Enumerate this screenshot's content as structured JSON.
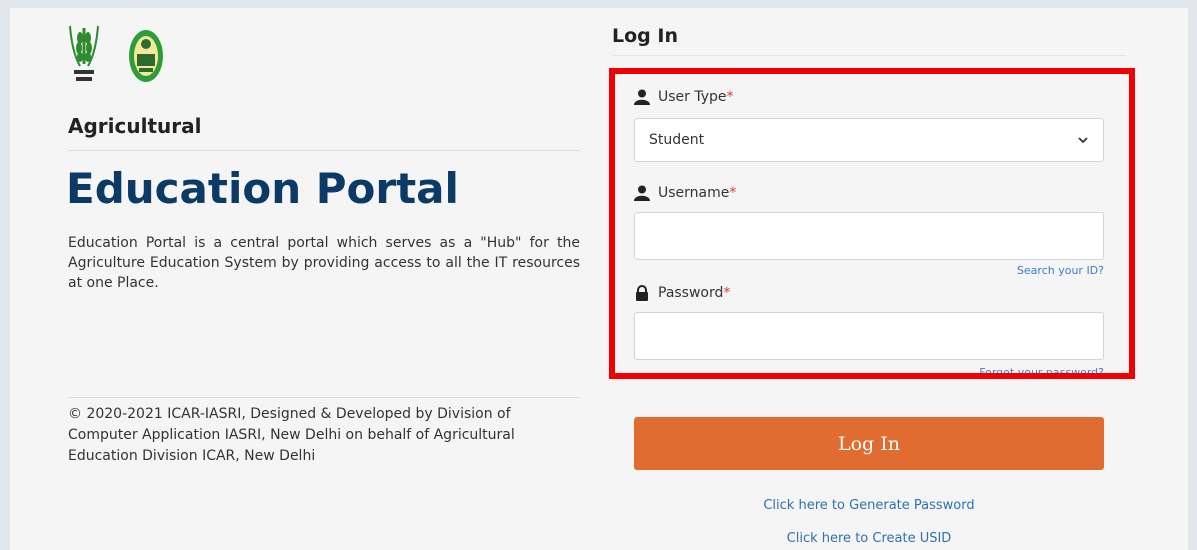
{
  "left": {
    "subtitle": "Agricultural",
    "title": "Education Portal",
    "description": "Education Portal is a central portal which serves as a \"Hub\" for the Agriculture Education System by providing access to all the IT resources at one Place.",
    "footer": "© 2020-2021 ICAR-IASRI, Designed & Developed by Division of Computer Application IASRI, New Delhi on behalf of Agricultural Education Division ICAR, New Delhi",
    "logos": [
      "icar-logo",
      "university-logo"
    ]
  },
  "login": {
    "heading": "Log In",
    "user_type_label": "User Type",
    "user_type_value": "Student",
    "username_label": "Username",
    "username_value": "",
    "search_id_link": "Search your ID?",
    "password_label": "Password",
    "password_value": "",
    "forgot_password_link": "Forgot your password?",
    "required_marker": "*",
    "submit_label": "Log In",
    "generate_password_link": "Click here to Generate Password",
    "create_usid_link": "Click here to Create USID"
  },
  "colors": {
    "title": "#0b3a66",
    "button": "#e06c32",
    "highlight": "#f00000",
    "link": "#2e6fb5"
  }
}
